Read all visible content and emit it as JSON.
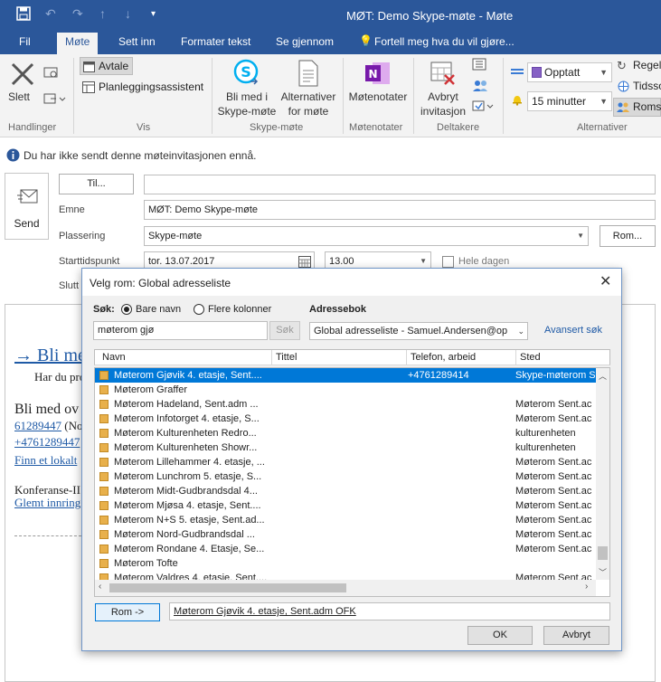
{
  "window": {
    "title": "MØT: Demo Skype-møte - Møte"
  },
  "tabs": [
    "Fil",
    "Møte",
    "Sett inn",
    "Formater tekst",
    "Se gjennom",
    "Fortell meg hva du vil gjøre..."
  ],
  "ribbon": {
    "delete": "Slett",
    "appointment": "Avtale",
    "scheduling": "Planleggingsassistent",
    "join_skype": "Bli med i",
    "join_skype2": "Skype-møte",
    "skype_alt": "Alternativer",
    "skype_alt2": "for møte",
    "meeting_notes": "Møtenotater",
    "cancel_inv": "Avbryt",
    "cancel_inv2": "invitasjon",
    "show_as": "Opptatt",
    "reminder": "15 minutter",
    "rules": "Regelm",
    "timezones": "Tidsso",
    "rooms": "Roms",
    "groups": {
      "handlinger": "Handlinger",
      "vis": "Vis",
      "skype": "Skype-møte",
      "notater": "Møtenotater",
      "deltakere": "Deltakere",
      "alternativer": "Alternativer"
    }
  },
  "info_bar": "Du har ikke sendt denne møteinvitasjonen ennå.",
  "form": {
    "send": "Send",
    "to_button": "Til...",
    "subject_label": "Emne",
    "subject": "MØT: Demo Skype-møte",
    "location_label": "Plassering",
    "location": "Skype-møte",
    "room_button": "Rom...",
    "start_label": "Starttidspunkt",
    "start_date": "tor. 13.07.2017",
    "start_time": "13.00",
    "all_day": "Hele dagen",
    "end_label": "Slutt"
  },
  "body": {
    "heading": "→ Bli me",
    "line1": "Har du pro",
    "line2": "Bli med ov",
    "phone1": "61289447",
    "phone1_rest": " (No",
    "phone2": "+4761289447",
    "link": "Finn et lokalt",
    "conf": "Konferanse-II",
    "forgot": "Glemt innring"
  },
  "dialog": {
    "title": "Velg rom: Global adresseliste",
    "search_label": "Søk:",
    "radio_names": "Bare navn",
    "radio_more": "Flere kolonner",
    "addressbook_label": "Adressebok",
    "search_value": "møterom gjø",
    "search_button": "Søk",
    "addressbook_value": "Global adresseliste - Samuel.Andersen@op",
    "advanced": "Avansert søk",
    "columns": [
      "Navn",
      "Tittel",
      "Telefon, arbeid",
      "Sted"
    ],
    "rows": [
      {
        "name": "Møterom Gjøvik 4. etasje, Sent....",
        "title": "",
        "phone": "+4761289414",
        "place": "Skype-møterom S",
        "selected": true
      },
      {
        "name": "Møterom Graffer",
        "title": "",
        "phone": "",
        "place": ""
      },
      {
        "name": "Møterom Hadeland, Sent.adm ...",
        "title": "",
        "phone": "",
        "place": "Møterom Sent.ac"
      },
      {
        "name": "Møterom Infotorget 4. etasje, S...",
        "title": "",
        "phone": "",
        "place": "Møterom Sent.ac"
      },
      {
        "name": "Møterom Kulturenheten Redro...",
        "title": "",
        "phone": "",
        "place": "kulturenheten"
      },
      {
        "name": "Møterom Kulturenheten Showr...",
        "title": "",
        "phone": "",
        "place": "kulturenheten"
      },
      {
        "name": "Møterom Lillehammer 4. etasje, ...",
        "title": "",
        "phone": "",
        "place": "Møterom Sent.ac"
      },
      {
        "name": "Møterom Lunchrom 5. etasje, S...",
        "title": "",
        "phone": "",
        "place": "Møterom Sent.ac"
      },
      {
        "name": "Møterom Midt-Gudbrandsdal 4...",
        "title": "",
        "phone": "",
        "place": "Møterom Sent.ac"
      },
      {
        "name": "Møterom Mjøsa 4. etasje, Sent....",
        "title": "",
        "phone": "",
        "place": "Møterom Sent.ac"
      },
      {
        "name": "Møterom N+S 5. etasje, Sent.ad...",
        "title": "",
        "phone": "",
        "place": "Møterom Sent.ac"
      },
      {
        "name": "Møterom Nord-Gudbrandsdal ...",
        "title": "",
        "phone": "",
        "place": "Møterom Sent.ac"
      },
      {
        "name": "Møterom Rondane 4. Etasje, Se...",
        "title": "",
        "phone": "",
        "place": "Møterom Sent.ac"
      },
      {
        "name": "Møterom Tofte",
        "title": "",
        "phone": "",
        "place": ""
      },
      {
        "name": "Møterom Valdres 4. etasje, Sent....",
        "title": "",
        "phone": "",
        "place": "Møterom Sent.ac"
      }
    ],
    "room_button": "Rom ->",
    "room_value": "Møterom Gjøvik 4. etasje, Sent.adm OFK",
    "ok": "OK",
    "cancel": "Avbryt"
  }
}
